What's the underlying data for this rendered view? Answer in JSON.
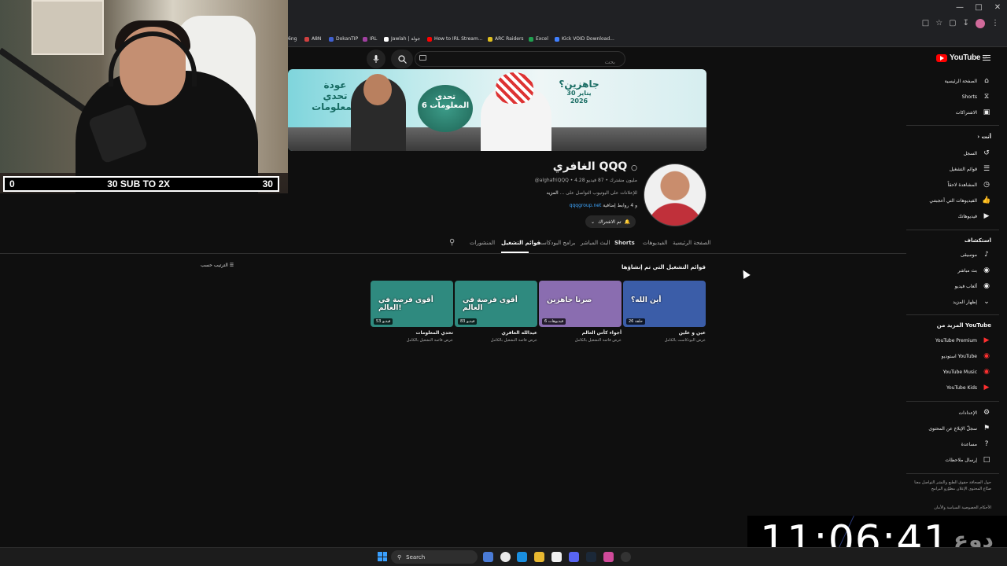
{
  "browser": {
    "bookmarks": [
      {
        "label": "6ng",
        "color": "#888888"
      },
      {
        "label": "A8N",
        "color": "#d04040"
      },
      {
        "label": "DokanTIP",
        "color": "#4060d0"
      },
      {
        "label": "IRL",
        "color": "#a040a0"
      },
      {
        "label": "Jawlah | جولة",
        "color": "#ffffff"
      },
      {
        "label": "How to IRL Stream...",
        "color": "#ff0000"
      },
      {
        "label": "ARC Raiders",
        "color": "#e0c020"
      },
      {
        "label": "Excel",
        "color": "#20a050"
      },
      {
        "label": "Kick VOID Download...",
        "color": "#4080ff"
      }
    ]
  },
  "youtube": {
    "search_placeholder": "بحث",
    "logo_text": "YouTube",
    "logo_country": "SA",
    "banner": {
      "left_text": "عودة تحدي المعلومات",
      "center_text": "تحدي المعلومات 6",
      "right_title": "جاهزين؟",
      "right_date_line1": "30 يناير",
      "right_date_line2": "2026"
    },
    "channel": {
      "title": "الغافري QQQ",
      "handle": "@alghafriQQQ",
      "meta": "@alghafriQQQ • 4.28 مليون مشترك • 87 فيديو",
      "description": "للإعلانات على اليوتيوب التواصل على ...",
      "more": "المزيد",
      "link": "qqqgroup.net",
      "link_extra": "و 4 روابط إضافية",
      "subscribe_label": "تم الاشتراك"
    },
    "tabs": [
      "الصفحة الرئيسية",
      "الفيديوهات",
      "Shorts",
      "البث المباشر",
      "برامج البودكاست",
      "قوائم التشغيل",
      "المنشورات"
    ],
    "section_title": "قوائم التشغيل التي تم إنشاؤها",
    "sort_label": "الترتيب حسب",
    "playlists": [
      {
        "name": "عين و علين",
        "count": "26 حلقة",
        "view_label": "عرض البودكاست بالكامل",
        "thumb_text": "أين الله؟",
        "color": "#3b5da8"
      },
      {
        "name": "أجواء كأس العالم",
        "count": "6 فيديوهات",
        "view_label": "عرض قائمة التشغيل بالكامل",
        "thumb_text": "صرنا جاهزين",
        "color": "#8a6db0"
      },
      {
        "name": "عيدالله الغافري",
        "count": "83 فيديو",
        "view_label": "عرض قائمة التشغيل بالكامل",
        "thumb_text": "أقوى فرصة في العالم",
        "color": "#2f8a7f"
      },
      {
        "name": "تحدي المعلومات",
        "count": "53 فيديو",
        "view_label": "عرض قائمة التشغيل بالكامل",
        "thumb_text": "أقوى فرصة في العالم!",
        "color": "#2f8a7f"
      }
    ],
    "sidebar": {
      "main": [
        {
          "label": "الصفحة الرئيسية",
          "icon": "home-icon"
        },
        {
          "label": "Shorts",
          "icon": "shorts-icon"
        },
        {
          "label": "الاشتراكات",
          "icon": "subscriptions-icon"
        }
      ],
      "you_header": "أنت",
      "you": [
        {
          "label": "السجل",
          "icon": "history-icon"
        },
        {
          "label": "قوائم التشغيل",
          "icon": "playlists-icon"
        },
        {
          "label": "المشاهدة لاحقاً",
          "icon": "watch-later-icon"
        },
        {
          "label": "الفيديوهات التي أعجبتني",
          "icon": "like-icon"
        },
        {
          "label": "فيديوهاتك",
          "icon": "your-videos-icon"
        }
      ],
      "explore_header": "استكشاف",
      "explore": [
        {
          "label": "موسيقى",
          "icon": "music-icon"
        },
        {
          "label": "بث مباشر",
          "icon": "live-icon"
        },
        {
          "label": "ألعاب فيديو",
          "icon": "gaming-icon"
        },
        {
          "label": "إظهار المزيد",
          "icon": "chevron-down-icon"
        }
      ],
      "more_header": "المزيد من YouTube",
      "more": [
        {
          "label": "YouTube Premium",
          "icon": "yt-premium-icon"
        },
        {
          "label": "استوديو YouTube",
          "icon": "yt-studio-icon"
        },
        {
          "label": "YouTube Music",
          "icon": "yt-music-icon"
        },
        {
          "label": "YouTube Kids",
          "icon": "yt-kids-icon"
        }
      ],
      "settings": [
        {
          "label": "الإعدادات",
          "icon": "settings-icon"
        },
        {
          "label": "سجلّ الإبلاغ عن المحتوى",
          "icon": "flag-icon"
        },
        {
          "label": "مساعدة",
          "icon": "help-icon"
        },
        {
          "label": "إرسال ملاحظات",
          "icon": "feedback-icon"
        }
      ],
      "footer1": "حول الصحافة حقوق الطبع والنشر التواصل معنا صنّاع المحتوى الإعلان مطوّرو البرامج",
      "footer2": "الأحكام الخصوصية السياسة والأمان"
    }
  },
  "overlay": {
    "goal_left": "0",
    "goal_center": "30 SUB TO 2X",
    "goal_right": "30",
    "clock_time": "11:06:41",
    "clock_logo": "دوع"
  },
  "taskbar": {
    "search_label": "Search"
  }
}
